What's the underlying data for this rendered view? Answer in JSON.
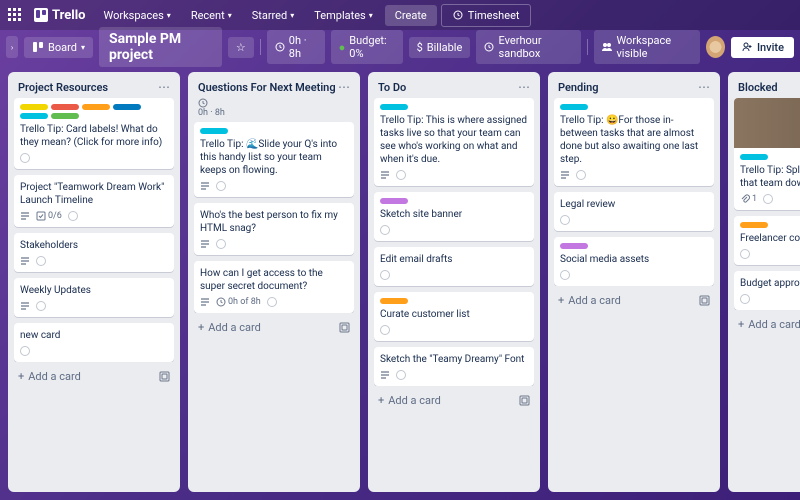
{
  "topbar": {
    "logo": "Trello",
    "nav": [
      "Workspaces",
      "Recent",
      "Starred",
      "Templates"
    ],
    "create": "Create",
    "timesheet": "Timesheet"
  },
  "boardbar": {
    "board_btn": "Board",
    "title": "Sample PM project",
    "time": "0h · 8h",
    "budget": "Budget: 0%",
    "billable": "Billable",
    "sandbox": "Everhour sandbox",
    "visibility": "Workspace visible",
    "invite": "Invite"
  },
  "lists": [
    {
      "title": "Project Resources",
      "cards": [
        {
          "labels": [
            "#f2d600",
            "#eb5a46",
            "#ff9f1a",
            "#0079bf",
            "#00c2e0",
            "#61bd4f"
          ],
          "text": "Trello Tip: Card labels! What do they mean? (Click for more info)",
          "badges": {}
        },
        {
          "text": "Project \"Teamwork Dream Work\" Launch Timeline",
          "badges": {
            "checklist": "0/6",
            "desc": true
          }
        },
        {
          "text": "Stakeholders",
          "badges": {
            "desc": true
          }
        },
        {
          "text": "Weekly Updates",
          "badges": {
            "desc": true
          }
        },
        {
          "text": "new card",
          "badges": {}
        }
      ]
    },
    {
      "title": "Questions For Next Meeting",
      "sub": "0h · 8h",
      "cards": [
        {
          "labels": [
            "#00c2e0"
          ],
          "text": "Trello Tip: 🌊Slide your Q's into this handy list so your team keeps on flowing.",
          "badges": {
            "desc": true
          }
        },
        {
          "text": "Who's the best person to fix my HTML snag?",
          "badges": {
            "desc": true
          }
        },
        {
          "text": "How can I get access to the super secret document?",
          "badges": {
            "time": "0h of 8h",
            "desc": true
          }
        }
      ]
    },
    {
      "title": "To Do",
      "cards": [
        {
          "labels": [
            "#00c2e0"
          ],
          "text": "Trello Tip: This is where assigned tasks live so that your team can see who's working on what and when it's due.",
          "badges": {
            "desc": true
          }
        },
        {
          "labels": [
            "#c377e0"
          ],
          "text": "Sketch site banner",
          "badges": {}
        },
        {
          "text": "Edit email drafts",
          "badges": {}
        },
        {
          "labels": [
            "#ff9f1a"
          ],
          "text": "Curate customer list",
          "badges": {}
        },
        {
          "text": "Sketch the \"Teamy Dreamy\" Font",
          "badges": {
            "desc": true
          }
        }
      ]
    },
    {
      "title": "Pending",
      "cards": [
        {
          "labels": [
            "#00c2e0"
          ],
          "text": "Trello Tip: 😀For those in-between tasks that are almost done but also awaiting one last step.",
          "badges": {
            "desc": true
          }
        },
        {
          "text": "Legal review",
          "badges": {}
        },
        {
          "labels": [
            "#c377e0"
          ],
          "text": "Social media assets",
          "badges": {}
        }
      ]
    },
    {
      "title": "Blocked",
      "cards": [
        {
          "img": true,
          "labels": [
            "#00c2e0"
          ],
          "text": "Trello Tip: Splash heavy issues that team down here.",
          "badges": {
            "attach": "1"
          }
        },
        {
          "labels": [
            "#ff9f1a"
          ],
          "text": "Freelancer contra",
          "badges": {}
        },
        {
          "text": "Budget approval",
          "badges": {}
        }
      ]
    }
  ],
  "add_card": "Add a card"
}
